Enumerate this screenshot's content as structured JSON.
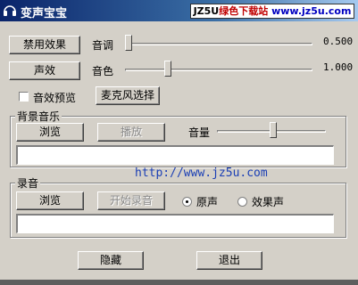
{
  "window": {
    "title": "变声宝宝",
    "watermark_prefix": "JZ5U",
    "watermark_highlight": "绿色下载站",
    "watermark_url": "www.jz5u.com"
  },
  "top": {
    "effect_button": "禁用效果",
    "sound_button": "声效",
    "pitch_label": "音调",
    "pitch_value": "0.500",
    "pitch_level": 0.0,
    "timbre_label": "音色",
    "timbre_value": "1.000",
    "timbre_level": 0.22,
    "preview_checkbox_label": "音效预览",
    "preview_checked": false,
    "mic_button": "麦克风选择"
  },
  "bgm": {
    "group_label": "背景音乐",
    "browse_button": "浏览",
    "play_button": "播放",
    "volume_label": "音量",
    "volume_level": 0.52,
    "file_path": ""
  },
  "watermark_url_text": "http://www.jz5u.com",
  "record": {
    "group_label": "录音",
    "browse_button": "浏览",
    "start_button": "开始录音",
    "radio_original_label": "原声",
    "radio_effect_label": "效果声",
    "selected": "original",
    "file_path": ""
  },
  "footer": {
    "hide_button": "隐藏",
    "exit_button": "退出"
  },
  "colors": {
    "face": "#d4d0c8",
    "title_start": "#0a246a",
    "title_end": "#a6caf0",
    "url": "#1b3fb5"
  },
  "icons": {
    "app": "headphones-icon"
  }
}
